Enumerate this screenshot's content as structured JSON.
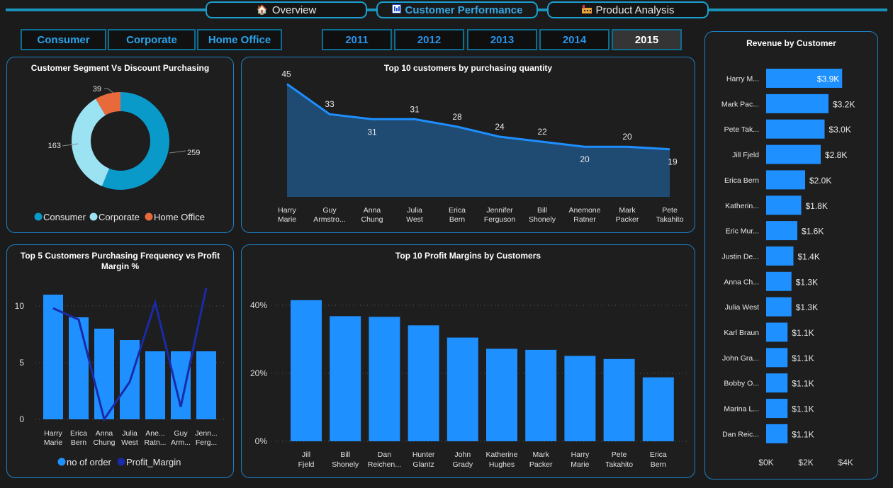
{
  "nav": {
    "overview": "Overview",
    "customer_performance": "Customer Performance",
    "product_analysis": "Product Analysis"
  },
  "segments": [
    "Consumer",
    "Corporate",
    "Home Office"
  ],
  "years": [
    "2011",
    "2012",
    "2013",
    "2014",
    "2015"
  ],
  "selected_year": "2015",
  "colors": {
    "accent": "#1e90ff",
    "consumer": "#0a9ac9",
    "corporate": "#9be3f2",
    "home_office": "#e86a3b",
    "profit_line": "#1a2ba8",
    "area": "#1f4a72"
  },
  "chart_data": [
    {
      "type": "pie",
      "title": "Customer Segment Vs Discount Purchasing",
      "categories": [
        "Consumer",
        "Corporate",
        "Home Office"
      ],
      "values": [
        259,
        163,
        39
      ],
      "labels": [
        "259",
        "163",
        "39"
      ],
      "legend": "bottom"
    },
    {
      "type": "area",
      "title": "Top 10 customers by purchasing quantity",
      "categories": [
        "Harry Marie",
        "Guy Armstro...",
        "Anna Chung",
        "Julia West",
        "Erica Bern",
        "Jennifer Ferguson",
        "Bill Shonely",
        "Anemone Ratner",
        "Mark Packer",
        "Pete Takahito"
      ],
      "values": [
        45,
        33,
        31,
        31,
        28,
        24,
        22,
        20,
        20,
        19
      ],
      "labels": [
        "45",
        "33",
        "31",
        "31",
        "28",
        "24",
        "22",
        "20",
        "20",
        "19"
      ],
      "ylim": [
        0,
        50
      ]
    },
    {
      "type": "bar",
      "title": "Top 5 Customers Purchasing Frequency vs Profit Margin %",
      "categories": [
        "Harry Marie",
        "Erica Bern",
        "Anna Chung",
        "Julia West",
        "Ane... Ratn...",
        "Guy Arm...",
        "Jenn... Ferg..."
      ],
      "series": [
        {
          "name": "no of order",
          "values": [
            11,
            9,
            8,
            7,
            6,
            6,
            6
          ]
        },
        {
          "name": "Profit_Margin",
          "values": [
            9.8,
            8.8,
            0,
            3.3,
            10.3,
            1.1,
            11.6
          ]
        }
      ],
      "yticks": [
        "0",
        "5",
        "10"
      ],
      "ylim": [
        0,
        12
      ],
      "legend": "bottom"
    },
    {
      "type": "bar",
      "title": "Top 10 Profit Margins by Customers",
      "categories": [
        "Jill Fjeld",
        "Bill Shonely",
        "Dan Reichen...",
        "Hunter Glantz",
        "John Grady",
        "Katherine Hughes",
        "Mark Packer",
        "Harry Marie",
        "Pete Takahito",
        "Erica Bern"
      ],
      "values": [
        41.5,
        36.8,
        36.6,
        34.1,
        30.5,
        27.2,
        26.9,
        25.1,
        24.2,
        18.8
      ],
      "yticks": [
        "0%",
        "20%",
        "40%"
      ],
      "ylim": [
        0,
        45
      ]
    },
    {
      "type": "bar",
      "title": "Revenue by Customer",
      "categories": [
        "Harry M...",
        "Mark Pac...",
        "Pete Tak...",
        "Jill Fjeld",
        "Erica Bern",
        "Katherin...",
        "Eric Mur...",
        "Justin De...",
        "Anna Ch...",
        "Julia West",
        "Karl Braun",
        "John Gra...",
        "Bobby O...",
        "Marina L...",
        "Dan Reic..."
      ],
      "values": [
        3900,
        3200,
        3000,
        2800,
        2000,
        1800,
        1600,
        1400,
        1300,
        1300,
        1100,
        1100,
        1100,
        1100,
        1100
      ],
      "labels": [
        "$3.9K",
        "$3.2K",
        "$3.0K",
        "$2.8K",
        "$2.0K",
        "$1.8K",
        "$1.6K",
        "$1.4K",
        "$1.3K",
        "$1.3K",
        "$1.1K",
        "$1.1K",
        "$1.1K",
        "$1.1K",
        "$1.1K"
      ],
      "xticks": [
        "$0K",
        "$2K",
        "$4K"
      ],
      "xlim": [
        0,
        4000
      ]
    }
  ]
}
